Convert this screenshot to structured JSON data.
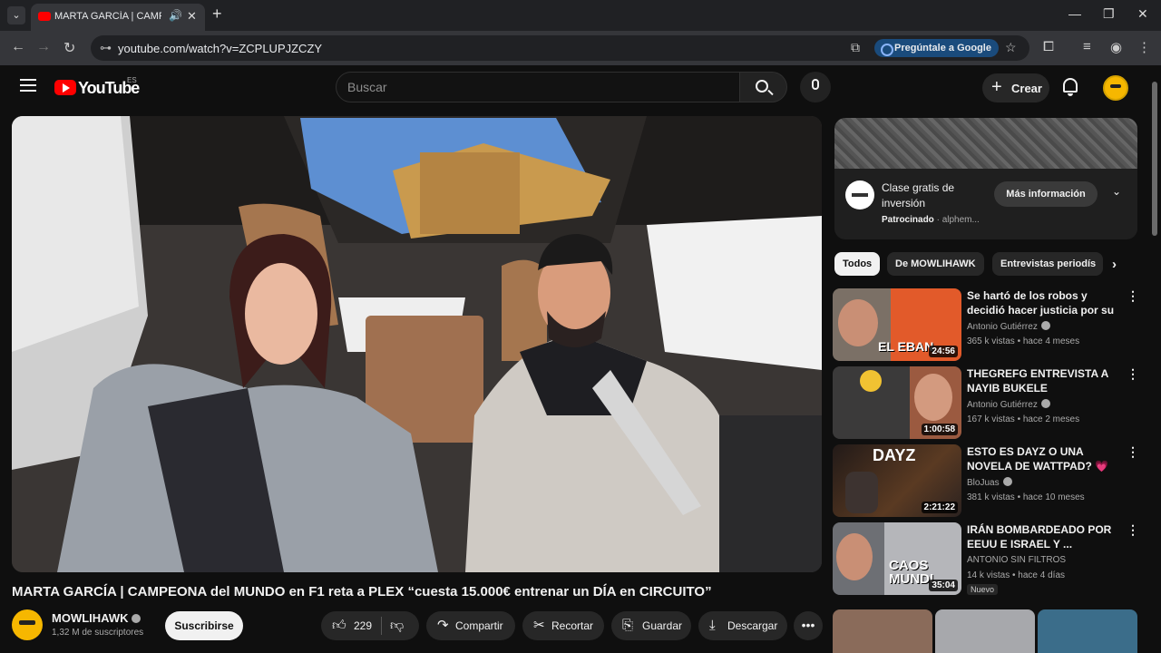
{
  "browser": {
    "tab_title": "MARTA GARCÍA | CAMPEONA",
    "url": "youtube.com/watch?v=ZCPLUPJZCZY",
    "google_chip": "Pregúntale a Google",
    "window_controls": [
      "minimize-icon",
      "maximize-icon",
      "close-icon"
    ]
  },
  "header": {
    "logo": "YouTube",
    "country": "ES",
    "search_placeholder": "Buscar",
    "create_label": "Crear"
  },
  "video": {
    "title": "MARTA GARCÍA | CAMPEONA del MUNDO en F1 reta a PLEX “cuesta 15.000€ entrenar un DÍA en CIRCUITO”",
    "channel": "MOWLIHAWK",
    "subscribers": "1,32 M de suscriptores",
    "subscribe_label": "Suscribirse",
    "likes": "229",
    "share_label": "Compartir",
    "clip_label": "Recortar",
    "save_label": "Guardar",
    "download_label": "Descargar"
  },
  "ad": {
    "title": "Clase gratis de inversión",
    "sponsored": "Patrocinado",
    "advertiser": "alphem...",
    "button": "Más información"
  },
  "chips": [
    "Todos",
    "De MOWLIHAWK",
    "Entrevistas periodís"
  ],
  "recommendations": [
    {
      "title": "Se hartó de los robos y decidió hacer justicia por su cuenta - ...",
      "channel": "Antonio Gutiérrez",
      "meta": "365 k vistas • hace 4 meses",
      "duration": "24:56",
      "badge": ""
    },
    {
      "title": "THEGREFG ENTREVISTA A NAYIB BUKELE",
      "channel": "Antonio Gutiérrez",
      "meta": "167 k vistas • hace 2 meses",
      "duration": "1:00:58",
      "badge": ""
    },
    {
      "title": "ESTO ES DAYZ O UNA NOVELA DE WATTPAD? 💗 DayZ ...",
      "channel": "BloJuas",
      "meta": "381 k vistas • hace 10 meses",
      "duration": "2:21:22",
      "badge": ""
    },
    {
      "title": "IRÁN BOMBARDEADO POR EEUU E ISRAEL Y ...",
      "channel": "ANTONIO SIN FILTROS",
      "meta": "14 k vistas • hace 4 días",
      "duration": "35:04",
      "badge": "Nuevo"
    }
  ],
  "thumb_text": {
    "t1": "EL EBAN",
    "t3": "DAYZ",
    "t4": "CAOS MUNDI"
  },
  "colors": {
    "bg": "#0f0f0f",
    "accent": "#ff0000",
    "chip_active": "#f1f1f1"
  }
}
